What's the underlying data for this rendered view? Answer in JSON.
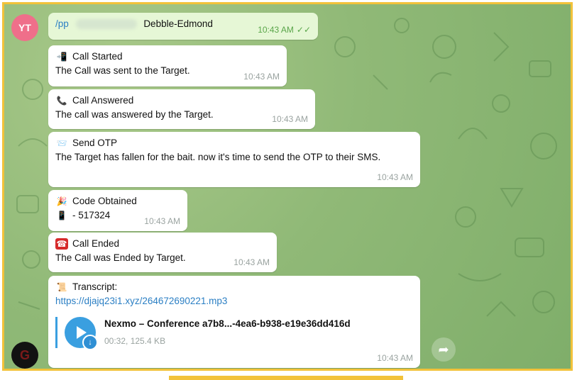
{
  "avatars": {
    "top_initials": "YT",
    "bottom_initial": "G"
  },
  "header_message": {
    "prefix": "/pp",
    "name": "Debble-Edmond",
    "time": "10:43 AM",
    "ticks": "✓✓"
  },
  "messages": [
    {
      "emoji": "📲",
      "title": "Call Started",
      "body": "The Call was sent to the Target.",
      "time": "10:43 AM"
    },
    {
      "emoji": "📞",
      "title": "Call Answered",
      "body": "The call was answered by the Target.",
      "time": "10:43 AM"
    },
    {
      "emoji": "📨",
      "title": "Send OTP",
      "body": "The Target has fallen for the bait. now it's time to send the OTP to their SMS.",
      "time": "10:43 AM"
    },
    {
      "emoji": "🎉",
      "title": "Code Obtained",
      "body_icon": "📱",
      "body": "- 517324",
      "time": "10:43 AM"
    },
    {
      "emoji": "☎",
      "title": "Call Ended",
      "body": "The Call was Ended by Target.",
      "time": "10:43 AM"
    }
  ],
  "transcript": {
    "emoji": "📜",
    "title": "Transcript:",
    "link": "https://djajq23i1.xyz/264672690221.mp3",
    "audio_title": "Nexmo – Conference a7b8...-4ea6-b938-e19e36dd416d",
    "audio_meta": "00:32, 125.4 KB",
    "time": "10:43 AM"
  },
  "icons": {
    "play": "play-icon",
    "download": "download-icon",
    "forward": "forward-icon"
  }
}
